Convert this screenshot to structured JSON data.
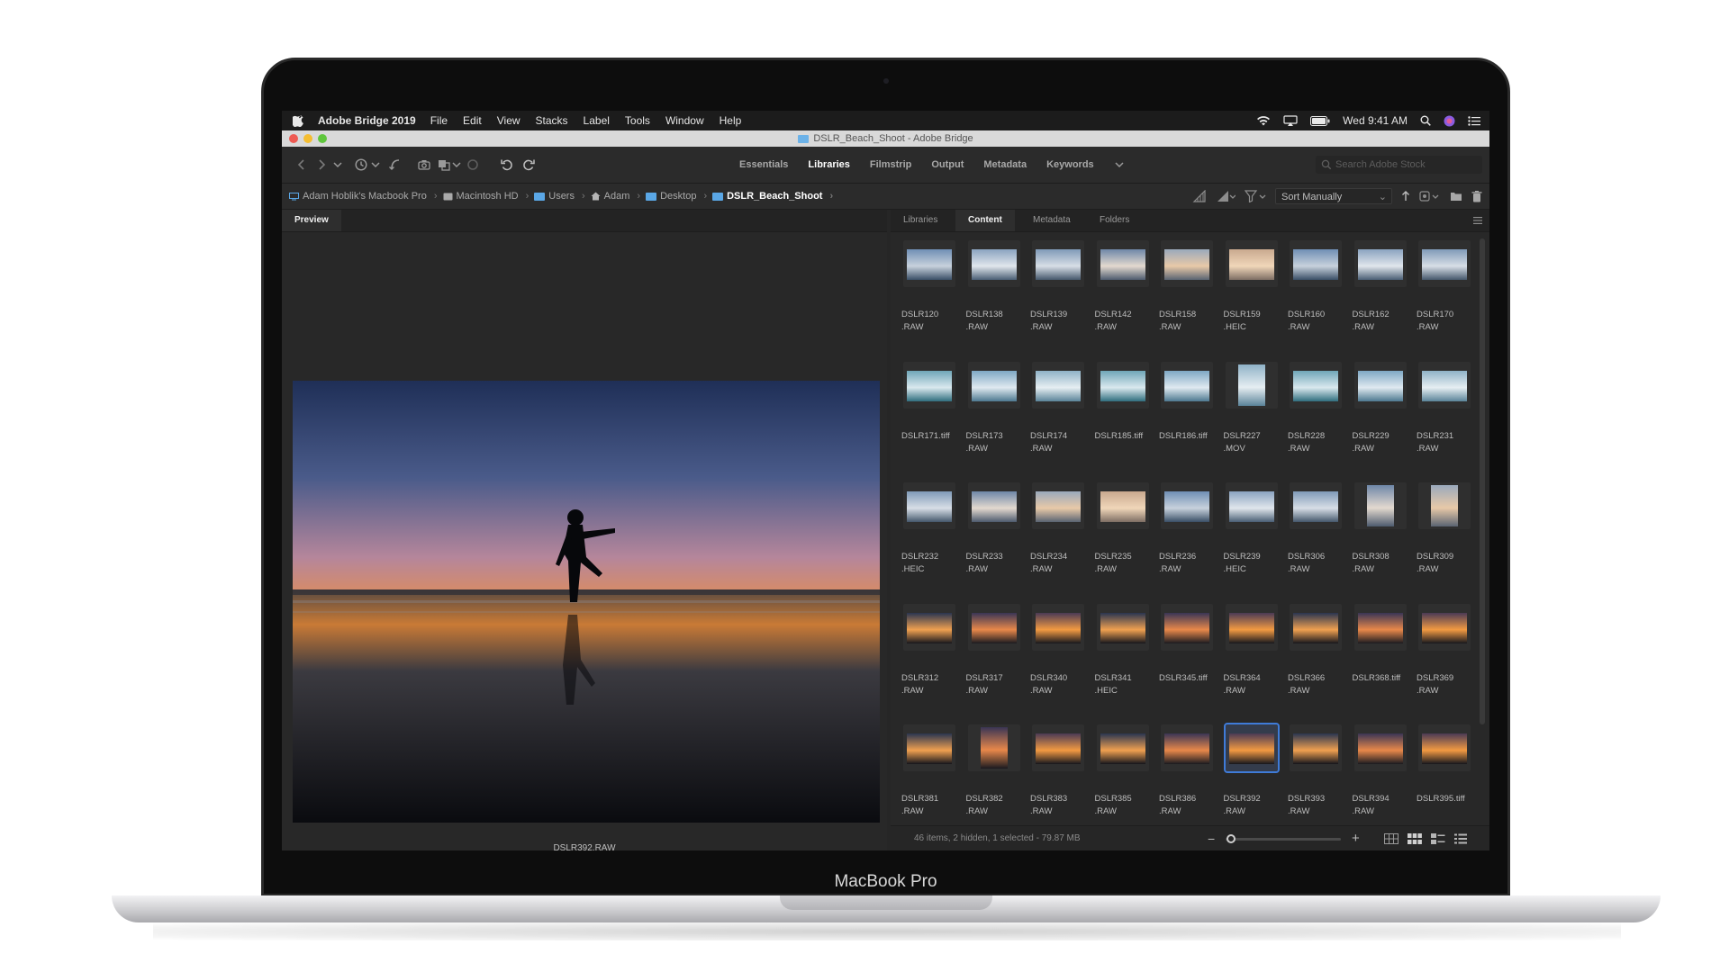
{
  "device": {
    "label": "MacBook Pro"
  },
  "menubar": {
    "app_name": "Adobe Bridge 2019",
    "items": [
      "File",
      "Edit",
      "View",
      "Stacks",
      "Label",
      "Tools",
      "Window",
      "Help"
    ],
    "clock": "Wed 9:41 AM"
  },
  "window": {
    "title": "DSLR_Beach_Shoot - Adobe Bridge"
  },
  "toolbar": {
    "workspaces": [
      {
        "label": "Essentials",
        "active": false
      },
      {
        "label": "Libraries",
        "active": true
      },
      {
        "label": "Filmstrip",
        "active": false
      },
      {
        "label": "Output",
        "active": false
      },
      {
        "label": "Metadata",
        "active": false
      },
      {
        "label": "Keywords",
        "active": false
      }
    ],
    "search_placeholder": "Search Adobe Stock"
  },
  "path": {
    "crumbs": [
      "Adam Hoblik's Macbook Pro",
      "Macintosh HD",
      "Users",
      "Adam",
      "Desktop",
      "DSLR_Beach_Shoot"
    ],
    "sort_label": "Sort Manually"
  },
  "preview": {
    "tab": "Preview",
    "caption": "DSLR392.RAW"
  },
  "content": {
    "tabs": [
      "Libraries",
      "Content",
      "Metadata",
      "Folders"
    ],
    "active_tab": "Content",
    "items": [
      "DSLR120\n.RAW",
      "DSLR138\n.RAW",
      "DSLR139\n.RAW",
      "DSLR142\n.RAW",
      "DSLR158\n.RAW",
      "DSLR159\n.HEIC",
      "DSLR160\n.RAW",
      "DSLR162\n.RAW",
      "DSLR170\n.RAW",
      "DSLR171.tiff",
      "DSLR173\n.RAW",
      "DSLR174\n.RAW",
      "DSLR185.tiff",
      "DSLR186.tiff",
      "DSLR227\n.MOV",
      "DSLR228\n.RAW",
      "DSLR229\n.RAW",
      "DSLR231\n.RAW",
      "DSLR232\n.HEIC",
      "DSLR233\n.RAW",
      "DSLR234\n.RAW",
      "DSLR235\n.RAW",
      "DSLR236\n.RAW",
      "DSLR239\n.HEIC",
      "DSLR306\n.RAW",
      "DSLR308\n.RAW",
      "DSLR309\n.RAW",
      "DSLR312\n.RAW",
      "DSLR317\n.RAW",
      "DSLR340\n.RAW",
      "DSLR341\n.HEIC",
      "DSLR345.tiff",
      "DSLR364\n.RAW",
      "DSLR366\n.RAW",
      "DSLR368.tiff",
      "DSLR369\n.RAW",
      "DSLR381\n.RAW",
      "DSLR382\n.RAW",
      "DSLR383\n.RAW",
      "DSLR385\n.RAW",
      "DSLR386\n.RAW",
      "DSLR392\n.RAW",
      "DSLR393\n.RAW",
      "DSLR394\n.RAW",
      "DSLR395.tiff"
    ],
    "selected_item": "DSLR392\n.RAW",
    "status": "46 items, 2 hidden, 1 selected - 79.87 MB",
    "thumbnail_zoom": 0.05
  },
  "colors": {
    "accent": "#3f7bd8",
    "folder": "#5aa7e6"
  }
}
